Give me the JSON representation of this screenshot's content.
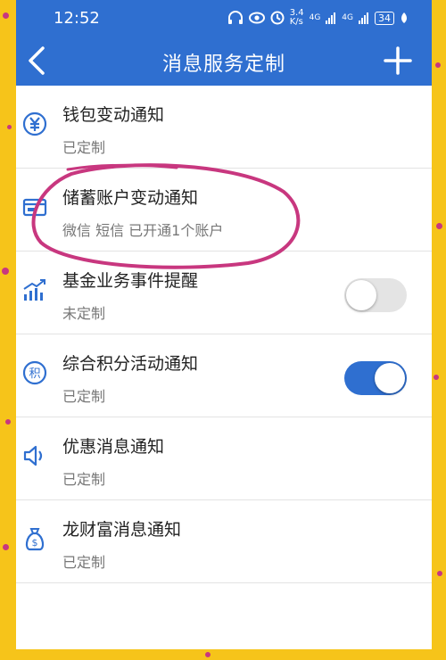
{
  "status_bar": {
    "time": "12:52",
    "network_speed": "3.4\nK/s",
    "signal_1": "4G",
    "signal_2": "4G",
    "battery": "34"
  },
  "header": {
    "title": "消息服务定制",
    "color": "#2f6fd0"
  },
  "items": [
    {
      "title": "钱包变动通知",
      "subtitle": "已定制",
      "icon": "yuan-circle-icon"
    },
    {
      "title": "储蓄账户变动通知",
      "subtitle": "微信 短信 已开通1个账户",
      "icon": "card-icon"
    },
    {
      "title": "基金业务事件提醒",
      "subtitle": "未定制",
      "icon": "chart-growth-icon",
      "toggle": false
    },
    {
      "title": "综合积分活动通知",
      "subtitle": "已定制",
      "icon": "points-icon",
      "toggle": true
    },
    {
      "title": "优惠消息通知",
      "subtitle": "已定制",
      "icon": "speaker-icon"
    },
    {
      "title": "龙财富消息通知",
      "subtitle": "已定制",
      "icon": "money-bag-icon"
    }
  ]
}
